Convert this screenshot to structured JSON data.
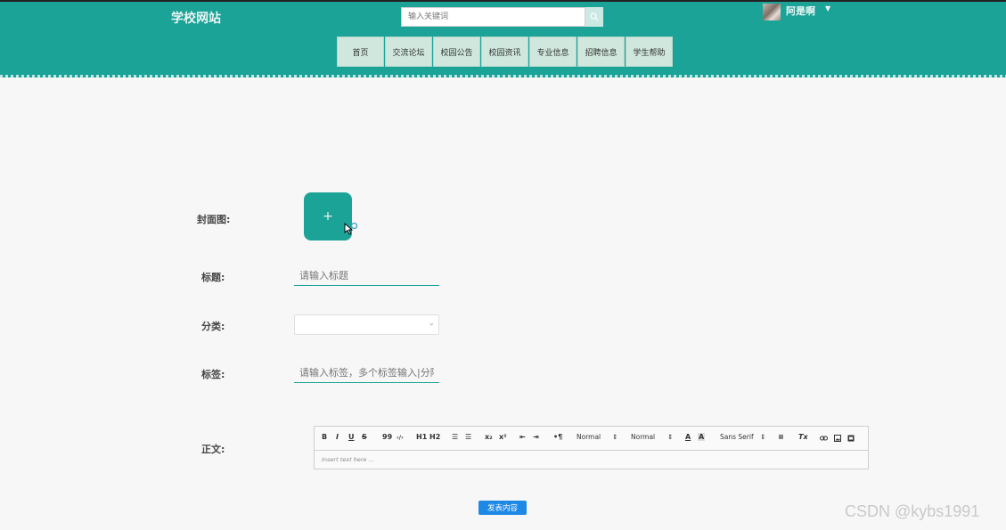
{
  "header": {
    "site_title": "学校网站",
    "search_placeholder": "输入关键词",
    "user_name": "阿是啊",
    "nav": [
      "首页",
      "交流论坛",
      "校园公告",
      "校园资讯",
      "专业信息",
      "招聘信息",
      "学生帮助"
    ]
  },
  "form": {
    "cover_label": "封面图:",
    "cover_plus": "+",
    "title_label": "标题:",
    "title_placeholder": "请输入标题",
    "category_label": "分类:",
    "tags_label": "标签:",
    "tags_placeholder": "请输入标签，多个标签输入|分隔",
    "content_label": "正文:",
    "submit": "发表内容"
  },
  "editor": {
    "toolbar": {
      "bold": "B",
      "italic": "I",
      "underline": "U",
      "strike": "S",
      "quote": "99",
      "code": "‹/›",
      "h1": "H1",
      "h2": "H2",
      "ol": "☰",
      "ul": "☰",
      "sub": "x₂",
      "sup": "x²",
      "outdent": "⇤",
      "indent": "⇥",
      "direction": "•¶",
      "size": "Normal",
      "header": "Normal",
      "color": "A",
      "background": "A",
      "font": "Sans Serif",
      "align": "≡",
      "clean": "Tx"
    },
    "placeholder": "Insert text here ..."
  },
  "watermark": "CSDN @kybs1991",
  "colors": {
    "primary": "#1ca398",
    "nav_bg": "#cfe7dc",
    "button": "#1e88e5"
  }
}
